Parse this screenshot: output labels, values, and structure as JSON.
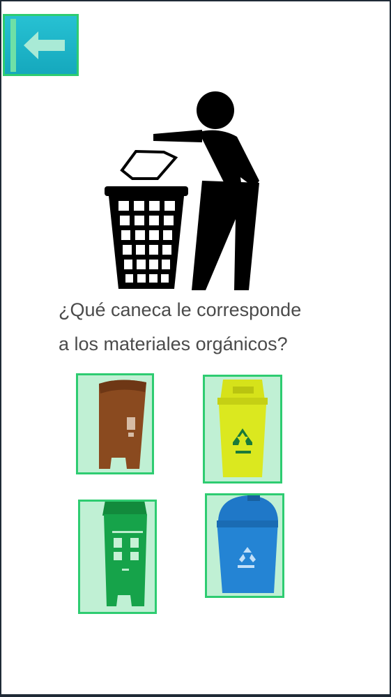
{
  "header": {
    "back_icon": "arrow-left-icon",
    "accent": "#1fb6c9"
  },
  "illustration": {
    "icon": "person-throwing-trash-icon"
  },
  "question": {
    "line1": "¿Qué caneca le corresponde",
    "line2": "a los materiales orgánicos?"
  },
  "options": [
    {
      "name": "brown-bin",
      "color": "#8a4a1f"
    },
    {
      "name": "yellow-bin",
      "color": "#d8e21c"
    },
    {
      "name": "green-bin",
      "color": "#16a34a"
    },
    {
      "name": "blue-bin",
      "color": "#1f78c8"
    }
  ],
  "highlight_color": "#2ecc71"
}
